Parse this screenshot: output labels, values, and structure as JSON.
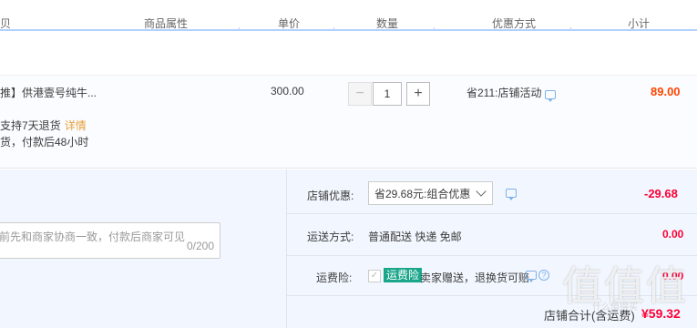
{
  "header": {
    "col_item": "贝",
    "col_attr": "商品属性",
    "col_price": "单价",
    "col_qty": "数量",
    "col_discount": "优惠方式",
    "col_subtotal": "小计"
  },
  "item": {
    "name": "推】供港壹号纯牛...",
    "price": "300.00",
    "quantity": "1",
    "minus_label": "−",
    "plus_label": "+",
    "discount": "省211:店铺活动",
    "subtotal": "89.00",
    "return_policy": "支持7天退货",
    "return_detail": "详情",
    "delivery": "货，付款后48小时"
  },
  "order_options": {
    "memo_placeholder": "前先和商家协商一致，付款后商家可见",
    "memo_count": "0/200",
    "coupon_label": "店铺优惠:",
    "coupon_value": "省29.68元:组合优惠",
    "coupon_amount": "-29.68",
    "shipping_label": "运送方式:",
    "shipping_value": "普通配送 快递 免邮",
    "shipping_amount": "0.00",
    "insurance_label": "运费险:",
    "insurance_badge": "运费险",
    "insurance_text": "卖家赠送，退换货可赔",
    "insurance_amount": "0.00",
    "total_label": "店铺合计(含运费)",
    "total_amount": "¥59.32"
  },
  "watermark": {
    "main": "值值值",
    "sub": "什么值得买"
  },
  "colors": {
    "accent_blue": "#b2d1ff",
    "price_orange": "#ff4400",
    "price_red": "#ff0036",
    "options_bg": "#f2f7ff",
    "insurance_green": "#1aa68a"
  },
  "icons": {
    "chat": "chat-bubble-icon",
    "dropdown": "chevron-down-icon",
    "help": "question-icon",
    "check": "checkbox-icon"
  }
}
